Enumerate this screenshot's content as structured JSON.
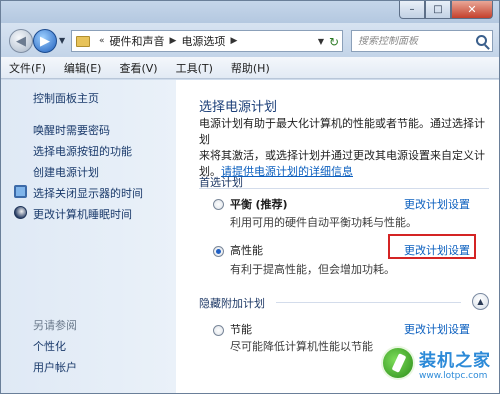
{
  "window": {
    "caption": {
      "minimize": "–",
      "maximize": "□",
      "close": "✕"
    }
  },
  "address": {
    "crumbs": [
      "硬件和声音",
      "电源选项"
    ],
    "search_placeholder": "搜索控制面板"
  },
  "menu": {
    "items": [
      "文件(F)",
      "编辑(E)",
      "查看(V)",
      "工具(T)",
      "帮助(H)"
    ]
  },
  "sidebar": {
    "home": "控制面板主页",
    "links": [
      "唤醒时需要密码",
      "选择电源按钮的功能",
      "创建电源计划",
      "选择关闭显示器的时间",
      "更改计算机睡眠时间"
    ],
    "see_also": "另请参阅",
    "see_also_links": [
      "个性化",
      "用户帐户"
    ]
  },
  "main": {
    "title": "选择电源计划",
    "desc_line1": "电源计划有助于最大化计算机的性能或者节能。通过选择计划",
    "desc_line2": "来将其激活，或选择计划并通过更改其电源设置来自定义计",
    "desc_line3_prefix": "划。",
    "desc_link": "请提供电源计划的详细信息",
    "preferred_heading": "首选计划",
    "hidden_heading": "隐藏附加计划",
    "change_label": "更改计划设置",
    "plans": [
      {
        "name": "平衡",
        "tag": "(推荐)",
        "desc": "利用可用的硬件自动平衡功耗与性能。",
        "selected": false
      },
      {
        "name": "高性能",
        "tag": "",
        "desc": "有利于提高性能，但会增加功耗。",
        "selected": true
      },
      {
        "name": "节能",
        "tag": "",
        "desc": "尽可能降低计算机性能以节能",
        "selected": false
      }
    ]
  },
  "watermark": {
    "name": "装机之家",
    "url": "www.lotpc.com"
  },
  "colors": {
    "link": "#0b5fbf",
    "title": "#1c3f78",
    "highlight": "#d42424"
  }
}
